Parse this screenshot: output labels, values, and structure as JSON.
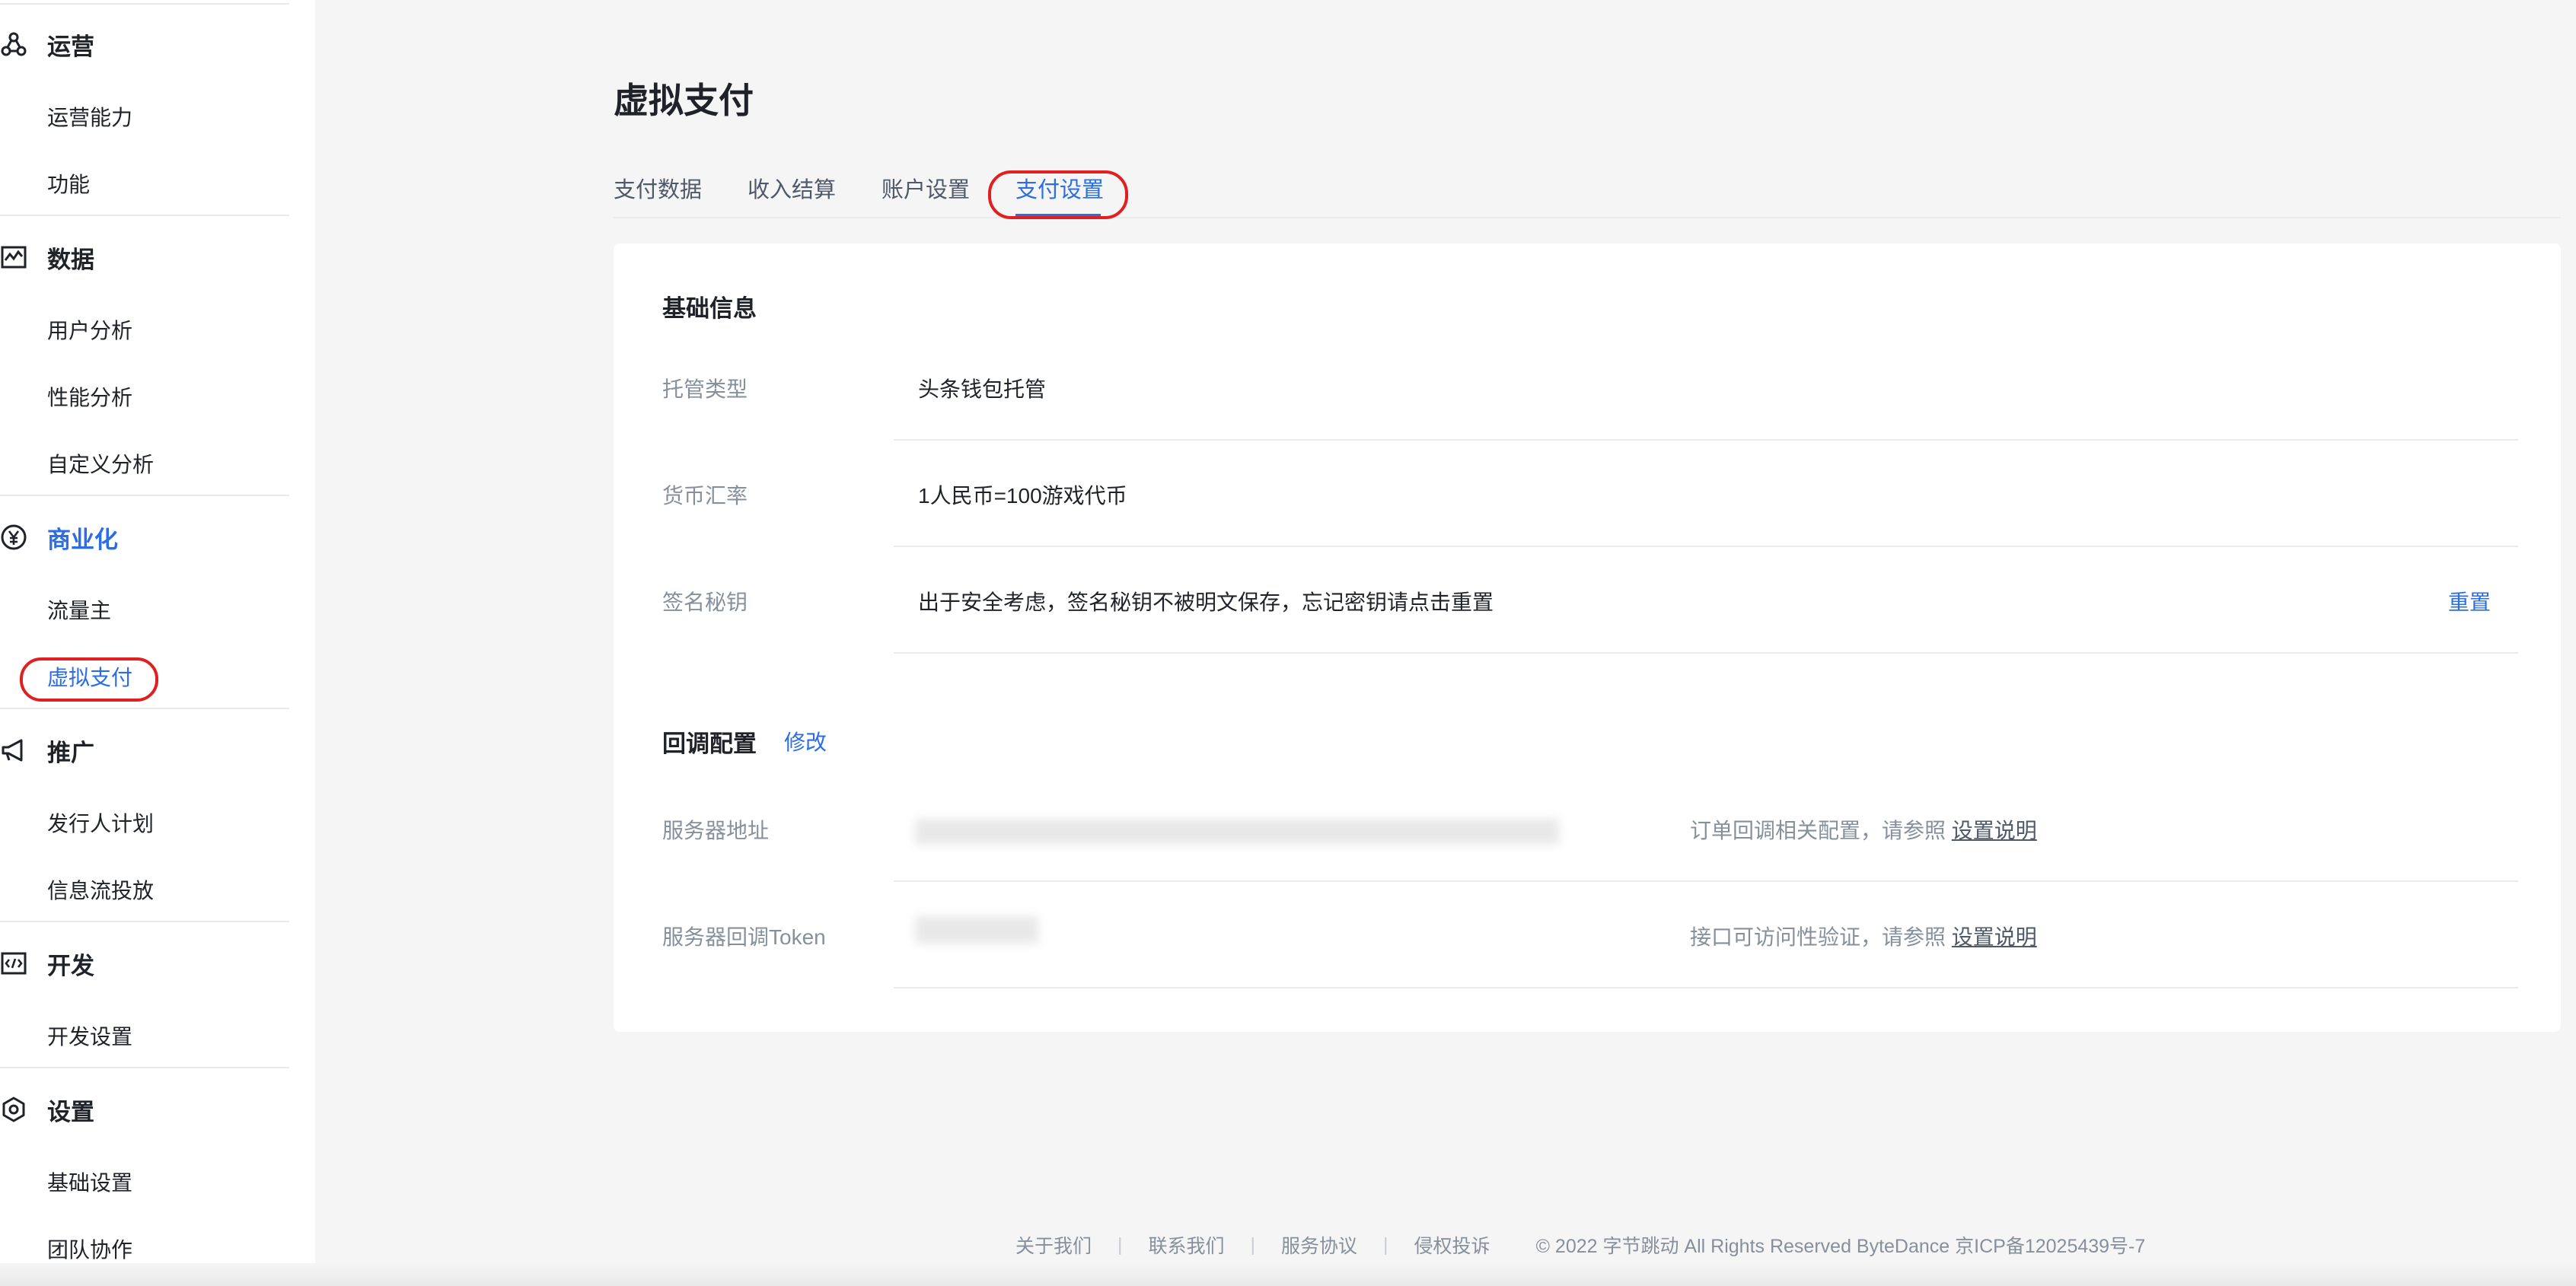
{
  "sidebar": {
    "groups": [
      {
        "label": "运营",
        "icon": "operations-icon",
        "items": [
          "运营能力",
          "功能"
        ]
      },
      {
        "label": "数据",
        "icon": "data-chart-icon",
        "items": [
          "用户分析",
          "性能分析",
          "自定义分析"
        ]
      },
      {
        "label": "商业化",
        "icon": "yen-icon",
        "items": [
          "流量主",
          "虚拟支付"
        ]
      },
      {
        "label": "推广",
        "icon": "megaphone-icon",
        "items": [
          "发行人计划",
          "信息流投放"
        ]
      },
      {
        "label": "开发",
        "icon": "code-icon",
        "items": [
          "开发设置"
        ]
      },
      {
        "label": "设置",
        "icon": "settings-icon",
        "items": [
          "基础设置",
          "团队协作"
        ]
      }
    ],
    "active_group": "商业化",
    "active_item": "虚拟支付"
  },
  "page": {
    "title": "虚拟支付",
    "tabs": [
      "支付数据",
      "收入结算",
      "账户设置",
      "支付设置"
    ],
    "active_tab": "支付设置"
  },
  "basic": {
    "title": "基础信息",
    "rows": [
      {
        "label": "托管类型",
        "value": "头条钱包托管"
      },
      {
        "label": "货币汇率",
        "value": "1人民币=100游戏代币"
      },
      {
        "label": "签名秘钥",
        "value": "出于安全考虑，签名秘钥不被明文保存，忘记密钥请点击重置",
        "action": "重置"
      }
    ]
  },
  "callback": {
    "title": "回调配置",
    "edit_label": "修改",
    "rows": [
      {
        "label": "服务器地址",
        "note": "订单回调相关配置，请参照",
        "link": "设置说明"
      },
      {
        "label": "服务器回调Token",
        "note": "接口可访问性验证，请参照",
        "link": "设置说明"
      }
    ]
  },
  "footer": {
    "links": [
      "关于我们",
      "联系我们",
      "服务协议",
      "侵权投诉"
    ],
    "copyright": "© 2022 字节跳动 All Rights Reserved ByteDance 京ICP备12025439号-7"
  },
  "colors": {
    "accent": "#2b6de5",
    "annotation": "#e02020",
    "muted": "#86909c"
  }
}
